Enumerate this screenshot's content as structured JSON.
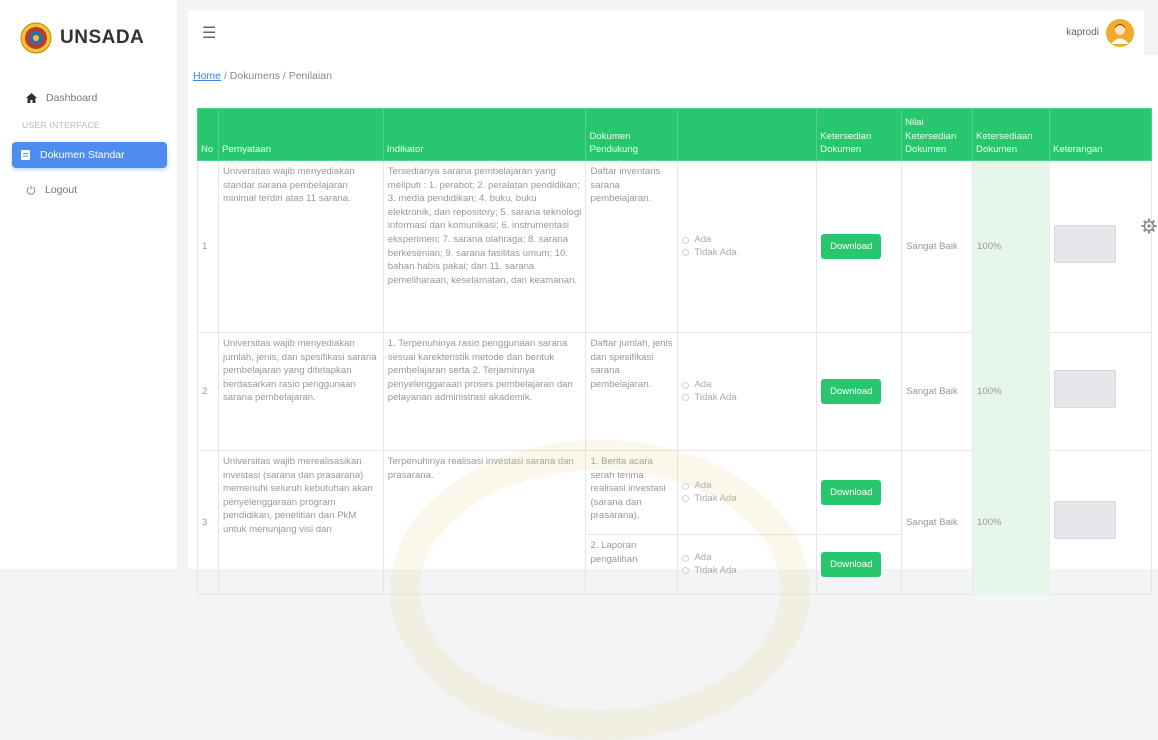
{
  "brand": {
    "name": "UNSADA"
  },
  "sidebar": {
    "dashboard": "Dashboard",
    "section": "USER INTERFACE",
    "dokumen_standar": "Dokumen Standar",
    "logout": "Logout"
  },
  "topbar": {
    "username": "kaprodi"
  },
  "breadcrumb": {
    "home": "Home",
    "rest": "/ Dokumens / Penilaian"
  },
  "table": {
    "headers": {
      "no": "No",
      "pernyataan": "Pernyataan",
      "indikator": "Indikator",
      "dokumen_pendukung": "Dokumen Pendukung",
      "blank": "",
      "ketersedian_dokumen": "Ketersedian Dokumen",
      "nilai": "Nilai Ketersedian Dokumen",
      "ketersediaan_dokumen": "Ketersediaan Dokumen",
      "keterangan": "Keterangan"
    },
    "rows": [
      {
        "no": "1",
        "pernyataan": "Universitas wajib menyediakan standar sarana pembelajaran minimal terdiri atas 11 sarana.",
        "indikator": "Tersedianya sarana pembelajaran yang meliputi : 1. perabot; 2. peralatan pendidikan; 3. media pendidikan; 4. buku, buku elektronik, dan repository; 5. sarana teknologi informasi dan komunikasi; 6. instrumentasi eksperimen; 7. sarana olahraga; 8. sarana berkesenian; 9. sarana fasilitas umum; 10. bahan habis pakai; dan 11. sarana pemeliharaan, keselamatan, dan keamanan.",
        "dokumen": "Daftar inventaris sarana pembelajaran.",
        "opt_ada": "Ada",
        "opt_tidak": "Tidak Ada",
        "download": "Download",
        "nilai": "Sangat Baik",
        "persen": "100%"
      },
      {
        "no": "2",
        "pernyataan": "Universitas wajib menyediakan jumlah, jenis, dan spesifikasi sarana pembelajaran yang ditetapkan berdasarkan rasio penggunaan sarana pembelajaran.",
        "indikator": "1. Terpenuhinya rasio penggunaan sarana sesuai karekteristik metode dan bentuk pembelajaran serta 2. Terjaminnya penyelenggaraan proses pembelajaran dan pelayanan administrasi akademik.",
        "dokumen": "Daftar jumlah, jenis dan spesifikasi sarana pembelajaran.",
        "opt_ada": "Ada",
        "opt_tidak": "Tidak Ada",
        "download": "Download",
        "nilai": "Sangat Baik",
        "persen": "100%"
      },
      {
        "no": "3",
        "pernyataan": "Universitas wajib merealisasikan investasi (sarana dan prasarana) memenuhi seluruh kebutuhan akan penyelenggaraan program pendidikan, penelitian dan PkM untuk menunjang visi dan",
        "indikator": "Terpenuhinya realisasi investasi sarana dan prasarana.",
        "dokumen_a": "1. Berita acara serah terima realisasi investasi (sarana dan prasarana).",
        "dokumen_b": "2. Laporan pengalihan",
        "opt_ada": "Ada",
        "opt_tidak": "Tidak Ada",
        "download": "Download",
        "nilai": "Sangat Baik",
        "persen": "100%"
      }
    ]
  },
  "colors": {
    "green": "#28c76f",
    "blue": "#4e8df0",
    "avatar": "#f2a92c"
  },
  "icons": [
    "unsada-logo-icon",
    "home-icon",
    "document-icon",
    "power-icon",
    "hamburger-icon",
    "user-avatar-icon",
    "gear-icon"
  ]
}
